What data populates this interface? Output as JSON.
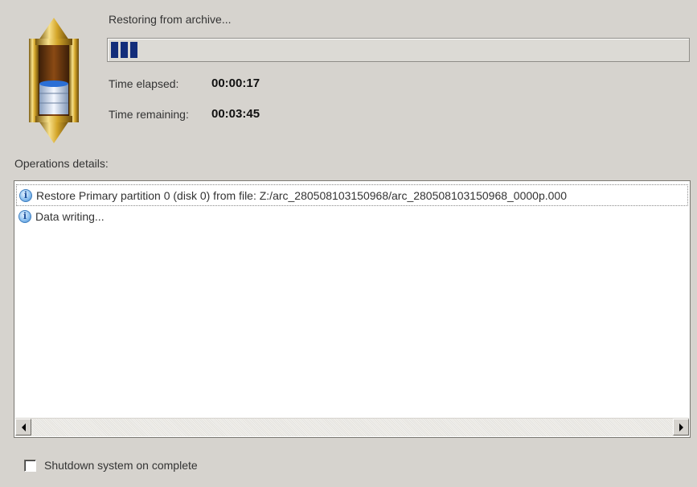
{
  "status": {
    "label": "Restoring from archive...",
    "progress": 0.06,
    "progress_chunks": 3
  },
  "time": {
    "elapsed_label": "Time elapsed:",
    "elapsed_value": "00:00:17",
    "remaining_label": "Time remaining:",
    "remaining_value": "00:03:45"
  },
  "operations": {
    "label": "Operations details:",
    "items": [
      {
        "icon": "info-icon",
        "text": "Restore Primary partition 0 (disk 0) from file: Z:/arc_280508103150968/arc_280508103150968_0000p.000"
      },
      {
        "icon": "info-icon",
        "text": "Data writing..."
      }
    ]
  },
  "options": {
    "shutdown_label": "Shutdown system on complete",
    "shutdown_checked": false
  },
  "colors": {
    "progress_fill": "#132d7a",
    "dialog_bg": "#d6d3ce",
    "accent_gold": "#c9a227"
  }
}
